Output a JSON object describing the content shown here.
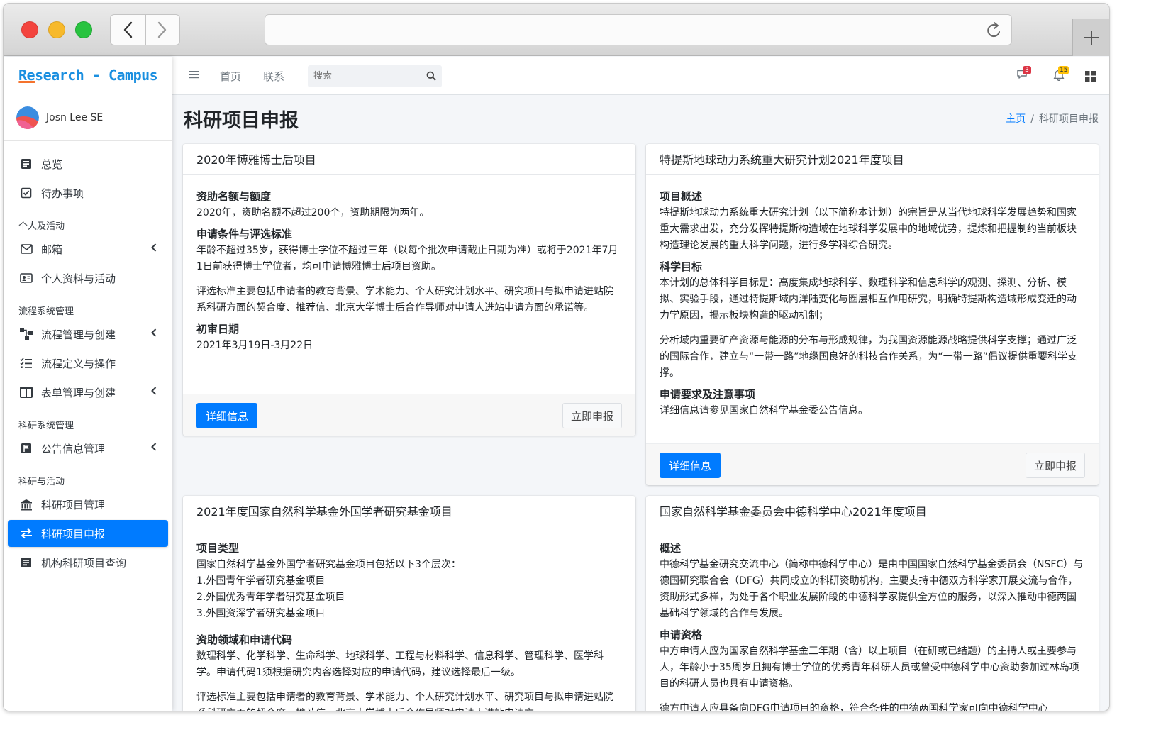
{
  "app": {
    "brand": "Research - Campus",
    "user_name": "Josn Lee SE"
  },
  "sidebar": {
    "items": [
      {
        "label": "总览",
        "icon": "file-text-icon"
      },
      {
        "label": "待办事项",
        "icon": "check-square-icon"
      }
    ],
    "sections": [
      {
        "header": "个人及活动",
        "items": [
          {
            "label": "邮箱",
            "icon": "envelope-icon",
            "has_submenu": true
          },
          {
            "label": "个人资料与活动",
            "icon": "id-card-icon",
            "has_submenu": false
          }
        ]
      },
      {
        "header": "流程系统管理",
        "items": [
          {
            "label": "流程管理与创建",
            "icon": "sitemap-icon",
            "has_submenu": true
          },
          {
            "label": "流程定义与操作",
            "icon": "list-check-icon",
            "has_submenu": false
          },
          {
            "label": "表单管理与创建",
            "icon": "columns-icon",
            "has_submenu": true
          }
        ]
      },
      {
        "header": "科研系统管理",
        "items": [
          {
            "label": "公告信息管理",
            "icon": "flag-icon",
            "has_submenu": true
          }
        ]
      },
      {
        "header": "科研与活动",
        "items": [
          {
            "label": "科研项目管理",
            "icon": "bank-icon",
            "has_submenu": false
          },
          {
            "label": "科研项目申报",
            "icon": "exchange-icon",
            "has_submenu": false,
            "active": true
          },
          {
            "label": "机构科研项目查询",
            "icon": "file-text-icon",
            "has_submenu": false
          }
        ]
      }
    ]
  },
  "topnav": {
    "home": "首页",
    "contact": "联系",
    "search_placeholder": "搜索",
    "messages_count": "3",
    "notifications_count": "15"
  },
  "page": {
    "title": "科研项目申报",
    "breadcrumb_home": "主页",
    "breadcrumb_current": "科研项目申报"
  },
  "cards": [
    {
      "title": "2020年博雅博士后项目",
      "sections": [
        {
          "heading": "资助名额与额度",
          "paragraphs": [
            "2020年，资助名额不超过200个，资助期限为两年。"
          ]
        },
        {
          "heading": "申请条件与评选标准",
          "paragraphs": [
            "年龄不超过35岁，获得博士学位不超过三年（以每个批次申请截止日期为准）或将于2021年7月1日前获得博士学位者，均可申请博雅博士后项目资助。",
            "评选标准主要包括申请者的教育背景、学术能力、个人研究计划水平、研究项目与拟申请进站院系科研方面的契合度、推荐信、北京大学博士后合作导师对申请人进站申请方面的承诺等。"
          ]
        },
        {
          "heading": "初审日期",
          "paragraphs": [
            "2021年3月19日-3月22日"
          ]
        }
      ],
      "detail_button": "详细信息",
      "apply_button": "立即申报"
    },
    {
      "title": "特提斯地球动力系统重大研究计划2021年度项目",
      "sections": [
        {
          "heading": "项目概述",
          "paragraphs": [
            "特提斯地球动力系统重大研究计划（以下简称本计划）的宗旨是从当代地球科学发展趋势和国家重大需求出发，充分发挥特提斯构造域在地球科学发展中的地域优势，提炼和把握制约当前板块构造理论发展的重大科学问题，进行多学科综合研究。"
          ]
        },
        {
          "heading": "科学目标",
          "paragraphs": [
            "本计划的总体科学目标是：高度集成地球科学、数理科学和信息科学的观测、探测、分析、模拟、实验手段，通过特提斯域内洋陆变化与圈层相互作用研究，明确特提斯构造域形成变迁的动力学原因，揭示板块构造的驱动机制；",
            "分析域内重要矿产资源与能源的分布与形成规律，为我国资源能源战略提供科学支撑；通过广泛的国际合作，建立与“一带一路”地缘国良好的科技合作关系，为“一带一路”倡议提供重要科学支撑。"
          ]
        },
        {
          "heading": "申请要求及注意事项",
          "paragraphs": [
            "详细信息请参见国家自然科学基金委公告信息。"
          ]
        }
      ],
      "detail_button": "详细信息",
      "apply_button": "立即申报"
    },
    {
      "title": "2021年度国家自然科学基金外国学者研究基金项目",
      "sections": [
        {
          "heading": "项目类型",
          "paragraphs": [
            "国家自然科学基金外国学者研究基金项目包括以下3个层次：",
            "1.外国青年学者研究基金项目",
            "2.外国优秀青年学者研究基金项目",
            "3.外国资深学者研究基金项目"
          ]
        },
        {
          "heading": "资助领域和申请代码",
          "paragraphs": [
            "数理科学、化学科学、生命科学、地球科学、工程与材料科学、信息科学、管理科学、医学科学。申请代码1须根据研究内容选择对应的申请代码，建议选择最后一级。",
            "评选标准主要包括申请者的教育背景、学术能力、个人研究计划水平、研究项目与拟申请进站院系科研方面的契合度、推荐信、北京大学博士后合作导师对申请人进站申请方"
          ]
        }
      ]
    },
    {
      "title": "国家自然科学基金委员会中德科学中心2021年度项目",
      "sections": [
        {
          "heading": "概述",
          "paragraphs": [
            "中德科学基金研究交流中心（简称中德科学中心）是由中国国家自然科学基金委员会（NSFC）与德国研究联合会（DFG）共同成立的科研资助机构，主要支持中德双方科学家开展交流与合作，资助形式多样，为处于各个职业发展阶段的中德科学家提供全方位的服务，以深入推动中德两国基础科学领域的合作与发展。"
          ]
        },
        {
          "heading": "申请资格",
          "paragraphs": [
            "中方申请人应为国家自然科学基金三年期（含）以上项目（在研或已结题）的主持人或主要参与人，年龄小于35周岁且拥有博士学位的优秀青年科研人员或曾受中德科学中心资助参加过林岛项目的科研人员也具有申请资格。",
            "德方申请人应具备向DFG申请项目的资格，符合条件的中德两国科学家可向中德科学中心"
          ]
        }
      ]
    }
  ],
  "colors": {
    "primary": "#007bff",
    "brand": "#1a8fe0",
    "brand_accent": "#f5732d",
    "badge_red": "#dc3545",
    "badge_yellow": "#ffc107"
  }
}
